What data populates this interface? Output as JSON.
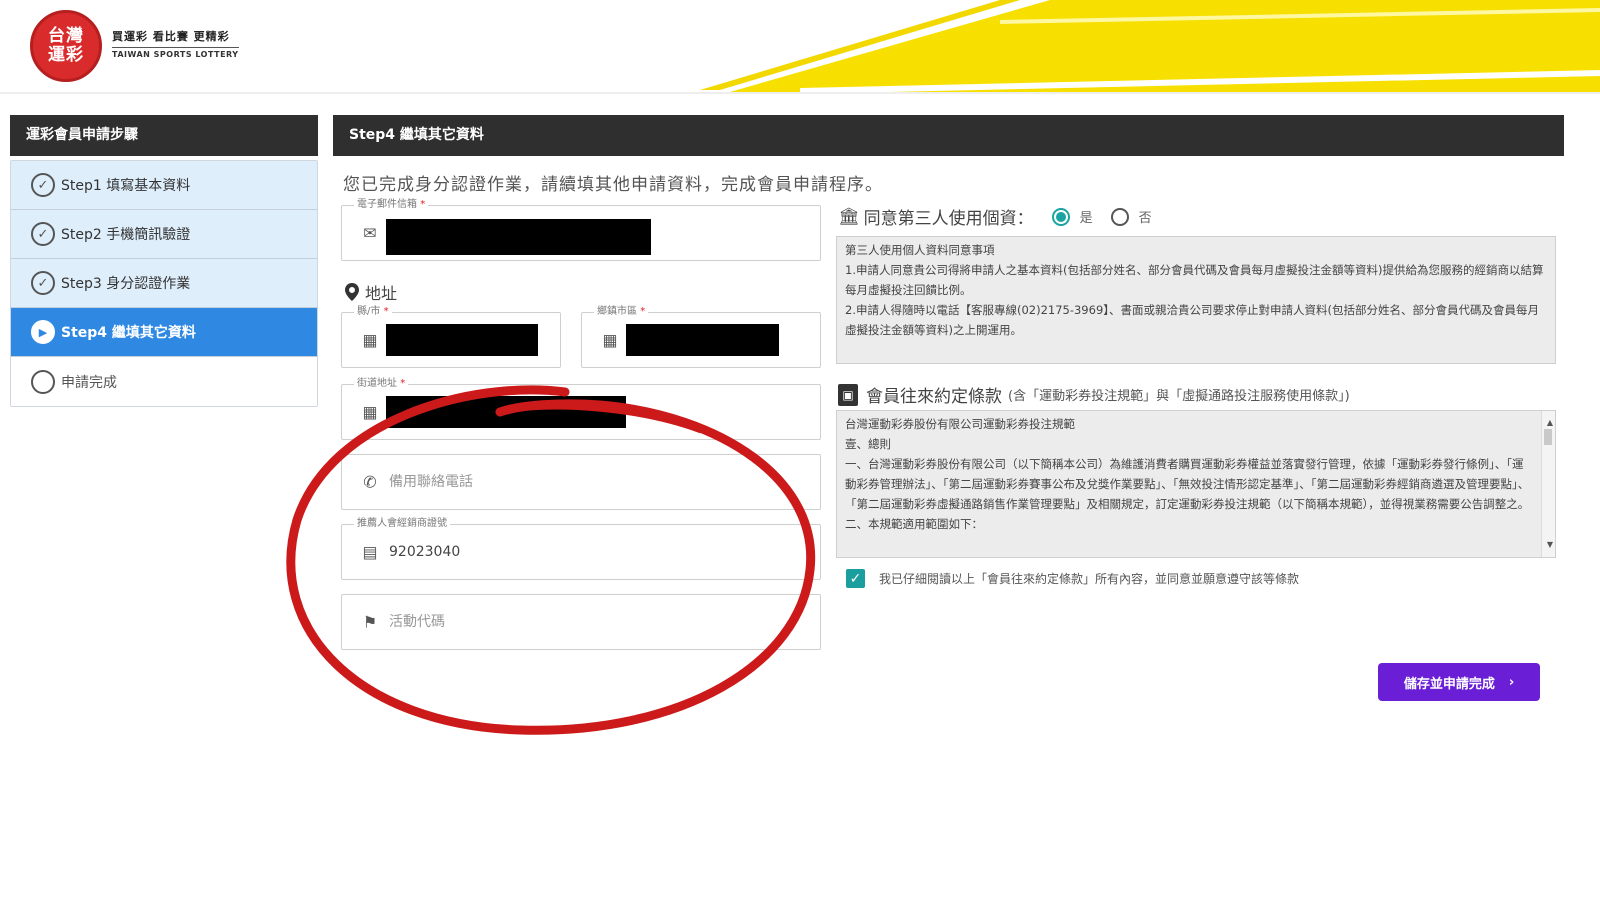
{
  "brand": {
    "logo_line1": "台灣",
    "logo_line2": "運彩",
    "slogan": "買運彩 看比賽 更精彩",
    "english": "TAIWAN SPORTS LOTTERY",
    "colors": {
      "logo_red": "#d92b2b",
      "accent_yellow": "#f7e000"
    }
  },
  "sidebar": {
    "title": "運彩會員申請步驟",
    "steps": [
      {
        "label": "Step1 填寫基本資料",
        "status": "done",
        "icon": "check-circle-icon"
      },
      {
        "label": "Step2 手機簡訊驗證",
        "status": "done",
        "icon": "check-circle-icon"
      },
      {
        "label": "Step3 身分認證作業",
        "status": "done",
        "icon": "check-circle-icon"
      },
      {
        "label": "Step4 繼填其它資料",
        "status": "active",
        "icon": "play-circle-icon"
      },
      {
        "label": "申請完成",
        "status": "todo",
        "icon": "empty-circle-icon"
      }
    ],
    "active_color": "#2f89e2"
  },
  "main": {
    "title": "Step4 繼填其它資料",
    "intro": "您已完成身分認證作業，請續填其他申請資料，完成會員申請程序。"
  },
  "form": {
    "email": {
      "label": "電子郵件信箱",
      "icon": "mail-icon"
    },
    "address_title": "地址",
    "county": {
      "label": "縣/市",
      "icon": "building-icon"
    },
    "district": {
      "label": "鄉鎮市區",
      "icon": "building-icon"
    },
    "street": {
      "label": "街道地址",
      "icon": "building-icon"
    },
    "backup_phone": {
      "placeholder": "備用聯絡電話",
      "icon": "phone-icon"
    },
    "referrer": {
      "label": "推薦人會經銷商證號",
      "value": "92023040",
      "icon": "store-icon"
    },
    "promo": {
      "placeholder": "活動代碼",
      "icon": "flag-icon"
    }
  },
  "consent": {
    "question": "同意第三人使用個資：",
    "yes": "是",
    "no": "否",
    "selected": "yes",
    "box_title": "第三人使用個人資料同意事項",
    "box_lines": [
      "1.申請人同意貴公司得將申請人之基本資料(包括部分姓名、部分會員代碼及會員每月虛擬投注金額等資料)提供給為您服務的經銷商以結算每月虛擬投注回饋比例。",
      "2.申請人得隨時以電話【客服專線(02)2175-3969】、書面或親洽貴公司要求停止對申請人資料(包括部分姓名、部分會員代碼及會員每月虛擬投注金額等資料)之上開運用。"
    ]
  },
  "terms": {
    "title": "會員往來約定條款",
    "subtitle": "(含「運動彩券投注規範」與「虛擬通路投注服務使用條款」)",
    "lines": [
      "台灣運動彩券股份有限公司運動彩券投注規範",
      "壹、總則",
      "一、台灣運動彩券股份有限公司（以下簡稱本公司）為維護消費者購買運動彩券權益並落實發行管理，依據「運動彩券發行條例」、「運動彩券管理辦法」、「第二屆運動彩券賽事公布及兌獎作業要點」、「無效投注情形認定基準」、「第二屆運動彩券經銷商遴選及管理要點」、「第二屆運動彩券虛擬通路銷售作業管理要點」及相關規定，訂定運動彩券投注規範（以下簡稱本規範），並得視業務需要公告調整之。",
      "二、本規範適用範圍如下："
    ],
    "agree_text": "我已仔細閱讀以上「會員往來約定條款」所有內容，並同意並願意遵守該等條款",
    "agreed": true
  },
  "actions": {
    "submit_label": "儲存並申請完成",
    "submit_color": "#6a1fd6"
  },
  "annotation": {
    "color": "#cc1a1a"
  }
}
